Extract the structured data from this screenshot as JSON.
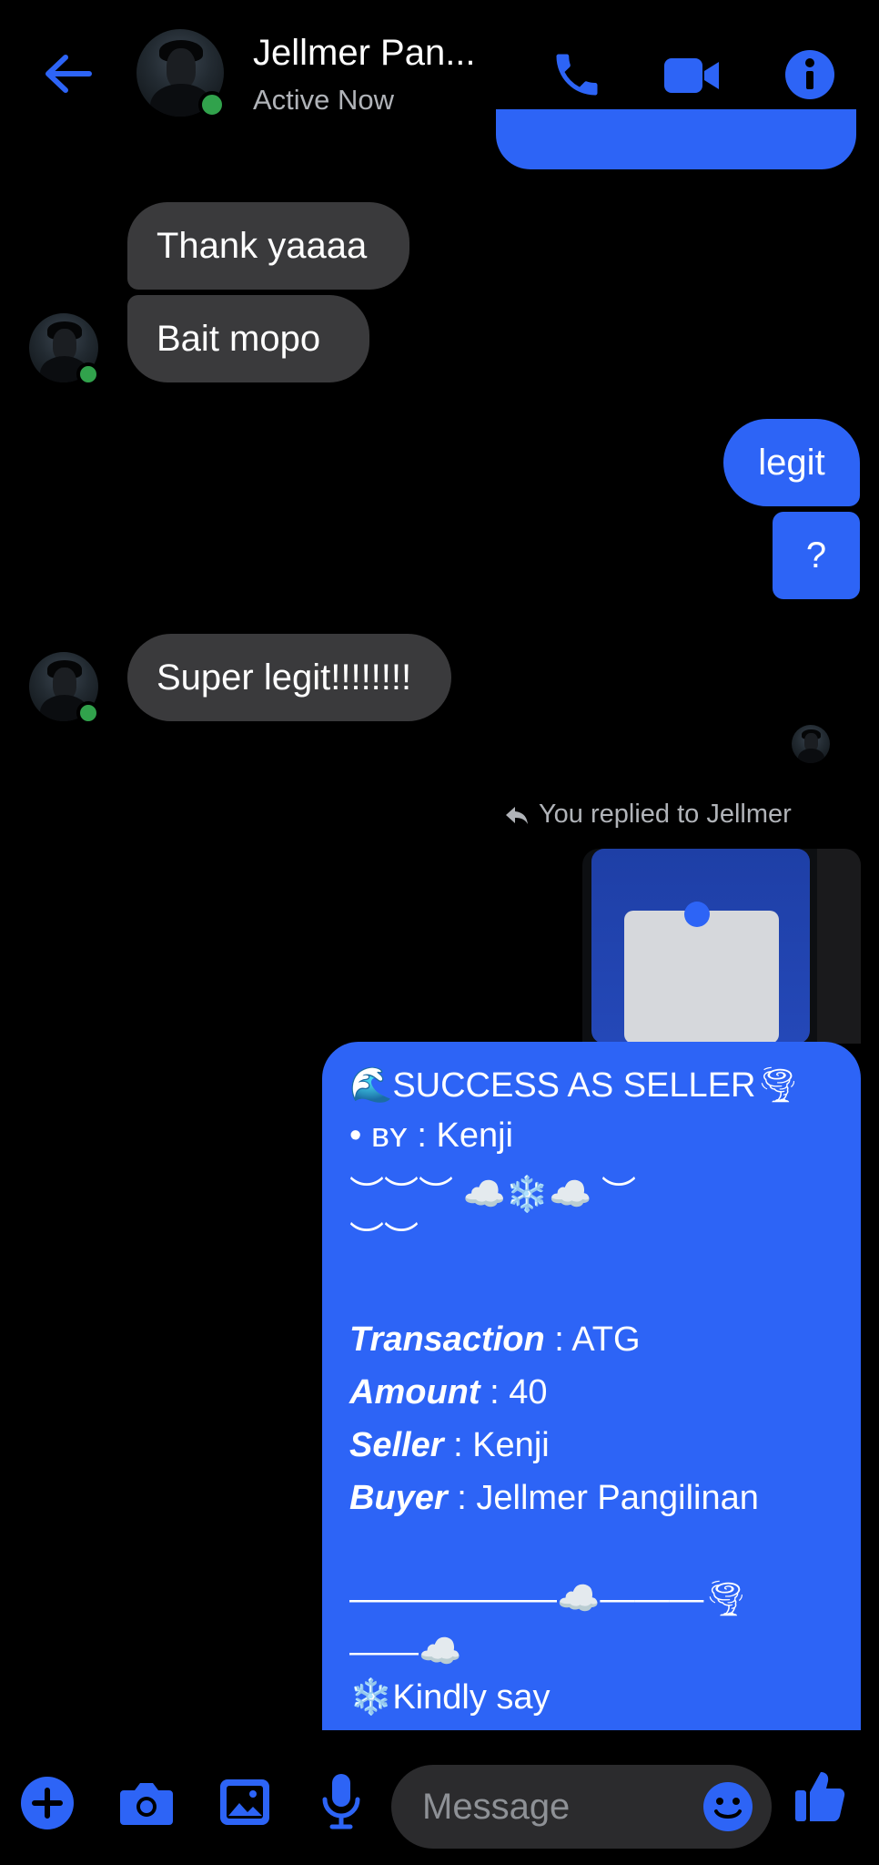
{
  "header": {
    "title": "Jellmer Pan...",
    "status": "Active Now"
  },
  "messages": {
    "in_1": "Thank yaaaa",
    "in_2": "Bait mopo",
    "out_1": "legit",
    "out_2": "?",
    "in_3": "Super legit!!!!!!!!",
    "reply_label": "You replied to Jellmer"
  },
  "receipt": {
    "line_1": "🌊SUCCESS AS SELLER🌪",
    "line_2_prefix": "• ʙʏ : ",
    "line_2_value": "Kenji",
    "line_3": "︶︶︶ ☁️❄️☁️ ︶",
    "line_4": "︶︶",
    "transaction_label": "Transaction",
    "transaction_value": " : ATG",
    "amount_label": "Amount",
    "amount_value": " : 40",
    "seller_label": "Seller",
    "seller_value": " : Kenji",
    "buyer_label": "Buyer",
    "buyer_value": " : Jellmer Pangilinan",
    "divider_1": "——————☁️———🌪",
    "divider_2": "——☁️",
    "closing": "❄️Kindly say"
  },
  "composer": {
    "placeholder": "Message"
  },
  "colors": {
    "accent": "#2d64f6",
    "incoming_bubble": "#3a3a3c",
    "online": "#31a24c"
  },
  "icons": [
    "back-arrow-icon",
    "phone-icon",
    "video-camera-icon",
    "info-icon",
    "reply-icon",
    "plus-icon",
    "camera-icon",
    "image-icon",
    "microphone-icon",
    "emoji-icon",
    "thumbs-up-icon"
  ]
}
